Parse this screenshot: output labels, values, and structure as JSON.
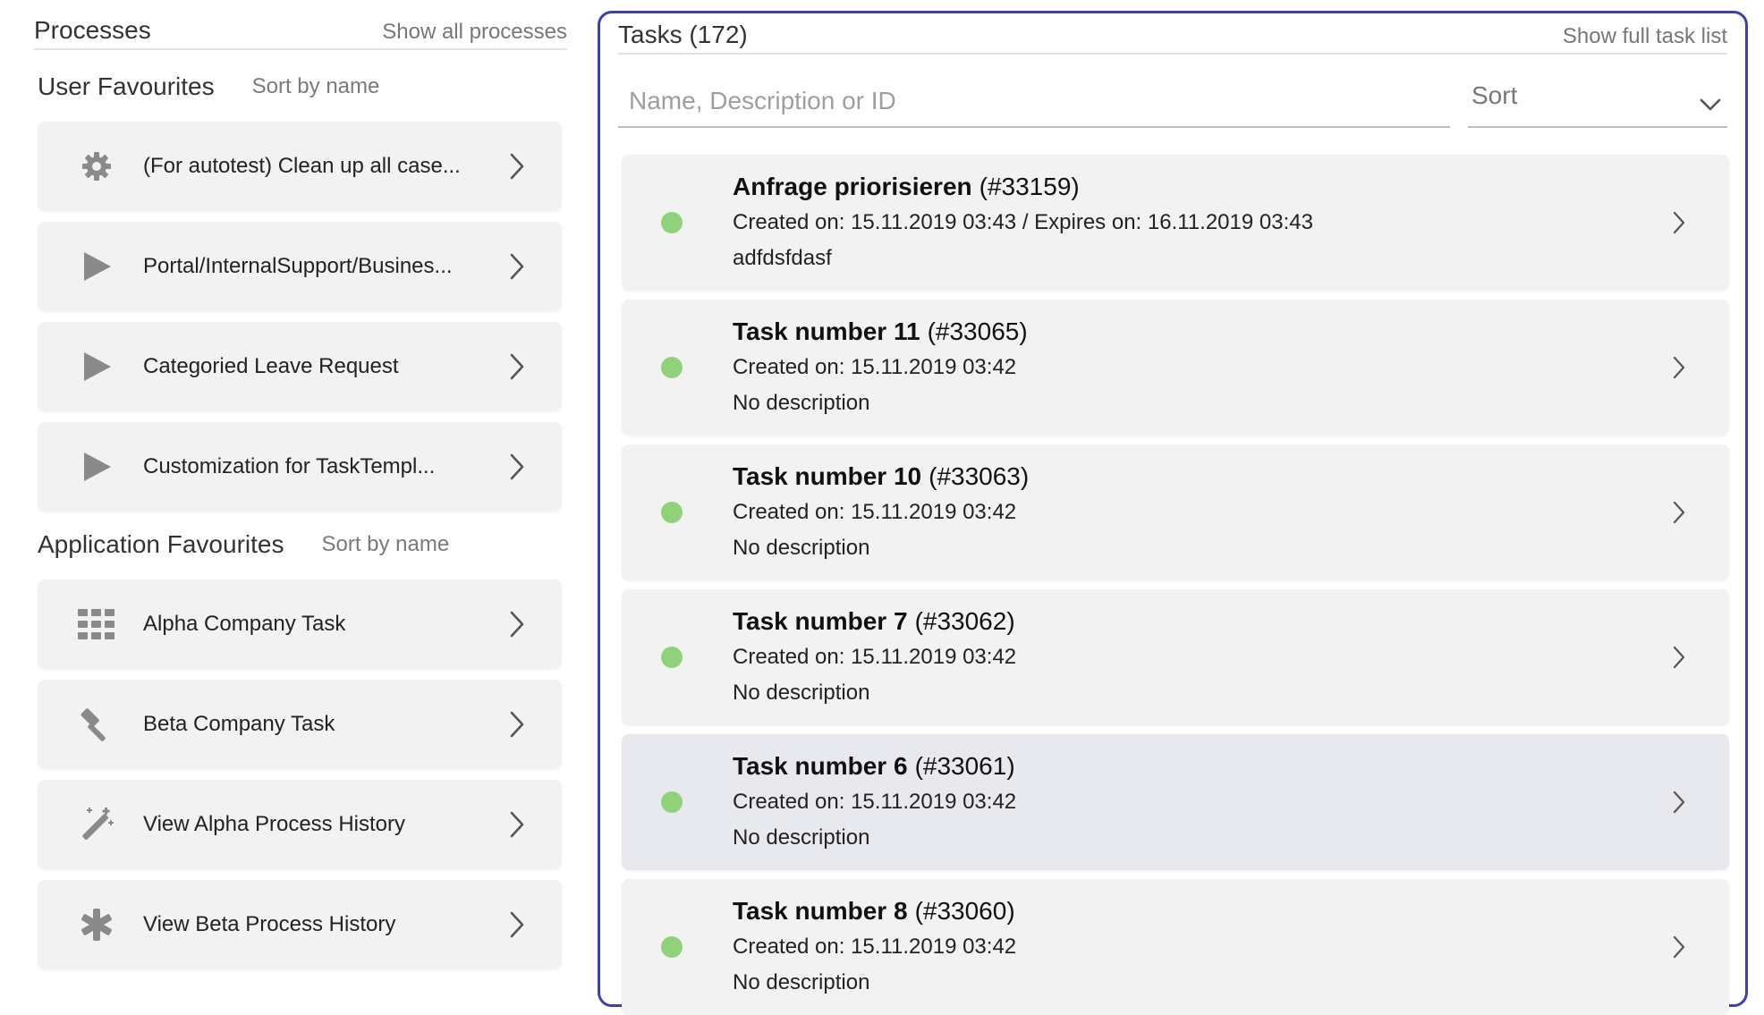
{
  "processes": {
    "title": "Processes",
    "show_all_label": "Show all processes",
    "user_favourites": {
      "title": "User Favourites",
      "sort_label": "Sort by name",
      "items": [
        {
          "label": "(For autotest) Clean up all case...",
          "icon": "gear-icon"
        },
        {
          "label": "Portal/InternalSupport/Busines...",
          "icon": "play-icon"
        },
        {
          "label": "Categoried Leave Request",
          "icon": "play-icon"
        },
        {
          "label": "Customization for TaskTempl...",
          "icon": "play-icon"
        }
      ]
    },
    "application_favourites": {
      "title": "Application Favourites",
      "sort_label": "Sort by name",
      "items": [
        {
          "label": "Alpha Company Task",
          "icon": "grid-icon"
        },
        {
          "label": "Beta Company Task",
          "icon": "gavel-icon"
        },
        {
          "label": "View Alpha Process History",
          "icon": "magic-wand-icon"
        },
        {
          "label": "View Beta Process History",
          "icon": "asterisk-icon"
        }
      ]
    }
  },
  "tasks": {
    "title": "Tasks (172)",
    "show_full_label": "Show full task list",
    "search_placeholder": "Name, Description or ID",
    "sort_label": "Sort",
    "items": [
      {
        "name": "Anfrage priorisieren",
        "id": "(#33159)",
        "dates": "Created on: 15.11.2019 03:43 / Expires on: 16.11.2019 03:43",
        "description": "adfdsfdasf",
        "state_color": "#8fd27a"
      },
      {
        "name": "Task number 11",
        "id": "(#33065)",
        "dates": "Created on: 15.11.2019 03:42",
        "description": "No description",
        "state_color": "#8fd27a"
      },
      {
        "name": "Task number 10",
        "id": "(#33063)",
        "dates": "Created on: 15.11.2019 03:42",
        "description": "No description",
        "state_color": "#8fd27a"
      },
      {
        "name": "Task number 7",
        "id": "(#33062)",
        "dates": "Created on: 15.11.2019 03:42",
        "description": "No description",
        "state_color": "#8fd27a"
      },
      {
        "name": "Task number 6",
        "id": "(#33061)",
        "dates": "Created on: 15.11.2019 03:42",
        "description": "No description",
        "state_color": "#8fd27a"
      },
      {
        "name": "Task number 8",
        "id": "(#33060)",
        "dates": "Created on: 15.11.2019 03:42",
        "description": "No description",
        "state_color": "#8fd27a"
      }
    ]
  },
  "colors": {
    "focus_border": "#3d3fb6",
    "card_background": "#f2f2f2",
    "hovered_card_background": "#e8e9ee",
    "state_open": "#8fd27a"
  }
}
